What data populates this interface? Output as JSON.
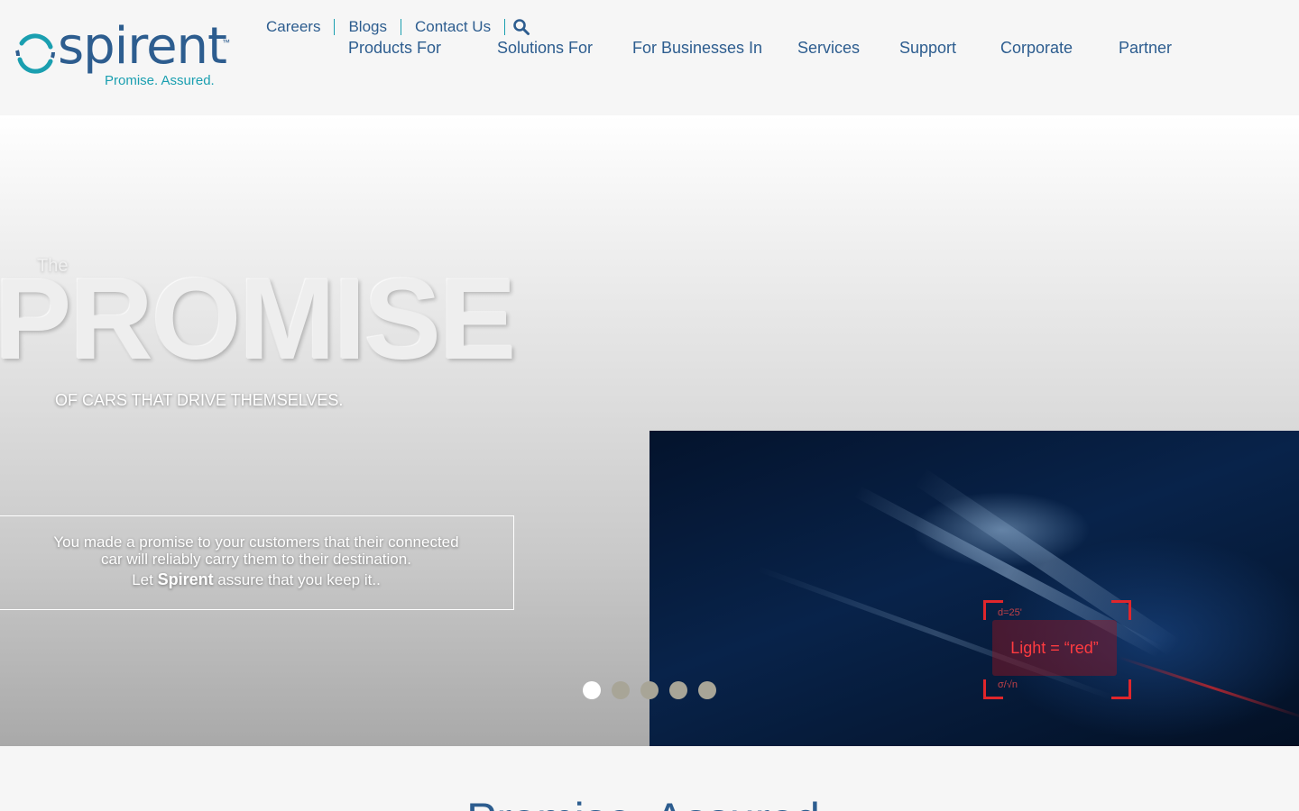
{
  "logo": {
    "word": "spirent",
    "tm": "™",
    "tagline": "Promise. Assured."
  },
  "utility_nav": {
    "items": [
      "Careers",
      "Blogs",
      "Contact Us"
    ]
  },
  "main_nav": {
    "items": [
      "Products For",
      "Solutions For",
      "For Businesses In",
      "Services",
      "Support",
      "Corporate",
      "Partner"
    ]
  },
  "hero": {
    "the": "The",
    "promise": "PROMISE",
    "subtitle": "OF CARS THAT DRIVE THEMSELVES.",
    "message": {
      "line1": "You made a promise to your customers that their connected",
      "line2": "car will reliably carry them to their destination.",
      "line3_before": "Let ",
      "line3_brand": "Spirent",
      "line3_after": " assure that you keep it.."
    },
    "image": {
      "label": "Light = “red”",
      "top_note": "d=25'",
      "bottom_note": "σ/√n"
    },
    "slider": {
      "count": 5,
      "active": 1
    }
  },
  "section": {
    "title": "Promise. Assured."
  },
  "colors": {
    "brand_blue": "#2d5d8f",
    "brand_teal": "#1a9fb0",
    "alert_red": "#e0262b"
  },
  "icons": {
    "search": "search-icon",
    "logo_ring": "logo-ring-icon"
  }
}
